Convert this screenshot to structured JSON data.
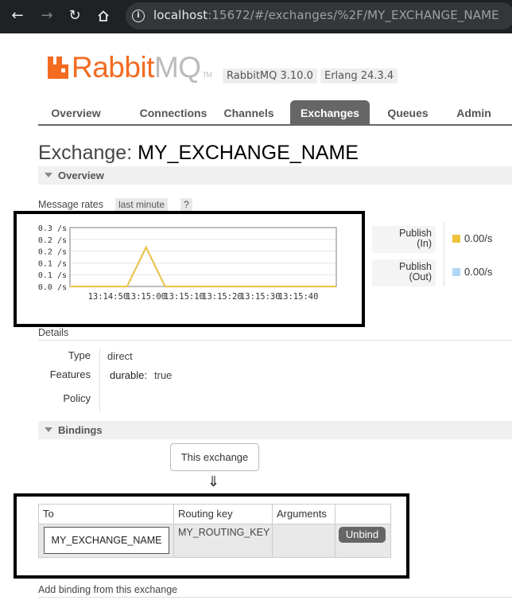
{
  "browser": {
    "url_host": "localhost",
    "url_rest": ":15672/#/exchanges/%2F/MY_EXCHANGE_NAME"
  },
  "header": {
    "logo_rabbit": "Rabbit",
    "logo_mq": "MQ",
    "logo_tm": "TM",
    "version_rabbitmq": "RabbitMQ 3.10.0",
    "version_erlang": "Erlang 24.3.4",
    "brand_color": "#f26b21"
  },
  "tabs": [
    {
      "label": "Overview"
    },
    {
      "label": "Connections"
    },
    {
      "label": "Channels"
    },
    {
      "label": "Exchanges",
      "active": true
    },
    {
      "label": "Queues"
    },
    {
      "label": "Admin"
    }
  ],
  "page": {
    "title_prefix": "Exchange:",
    "title_name": "MY_EXCHANGE_NAME"
  },
  "overview": {
    "header": "Overview",
    "message_rates_label": "Message rates",
    "range_chip": "last minute",
    "help_chip": "?"
  },
  "chart_data": {
    "type": "line",
    "x": [
      "13:14:50",
      "13:15:00",
      "13:15:10",
      "13:15:20",
      "13:15:30",
      "13:15:40"
    ],
    "y_ticks": [
      "0.3 /s",
      "0.2 /s",
      "0.2 /s",
      "0.1 /s",
      "0.1 /s",
      "0.0 /s"
    ],
    "ylim": [
      0,
      0.3
    ],
    "series": [
      {
        "name": "Publish (In)",
        "color": "#edc240",
        "points": [
          [
            -10,
            0
          ],
          [
            0,
            0
          ],
          [
            5,
            0
          ],
          [
            10,
            0.2
          ],
          [
            15,
            0
          ],
          [
            20,
            0
          ],
          [
            30,
            0
          ],
          [
            40,
            0
          ],
          [
            50,
            0
          ],
          [
            60,
            0
          ]
        ]
      },
      {
        "name": "Publish (Out)",
        "color": "#afd8f8",
        "points": [
          [
            -10,
            0
          ],
          [
            0,
            0
          ],
          [
            5,
            0
          ],
          [
            10,
            0.2
          ],
          [
            15,
            0
          ],
          [
            20,
            0
          ],
          [
            30,
            0
          ],
          [
            40,
            0
          ],
          [
            50,
            0
          ],
          [
            60,
            0
          ]
        ]
      }
    ],
    "grid": true
  },
  "legend": [
    {
      "line1": "Publish",
      "line2": "(In)",
      "value": "0.00/s",
      "color": "#edc240"
    },
    {
      "line1": "Publish",
      "line2": "(Out)",
      "value": "0.00/s",
      "color": "#afd8f8"
    }
  ],
  "details": {
    "header": "Details",
    "type_label": "Type",
    "type_value": "direct",
    "features_label": "Features",
    "features_key": "durable:",
    "features_value": "true",
    "policy_label": "Policy"
  },
  "bindings": {
    "header": "Bindings",
    "this_exchange": "This exchange",
    "arrow": "⇓",
    "columns": [
      "To",
      "Routing key",
      "Arguments"
    ],
    "rows": [
      {
        "to": "MY_EXCHANGE_NAME",
        "routing_key": "MY_ROUTING_KEY",
        "arguments": "",
        "action": "Unbind"
      }
    ]
  },
  "add_binding": {
    "label": "Add binding from this exchange"
  }
}
